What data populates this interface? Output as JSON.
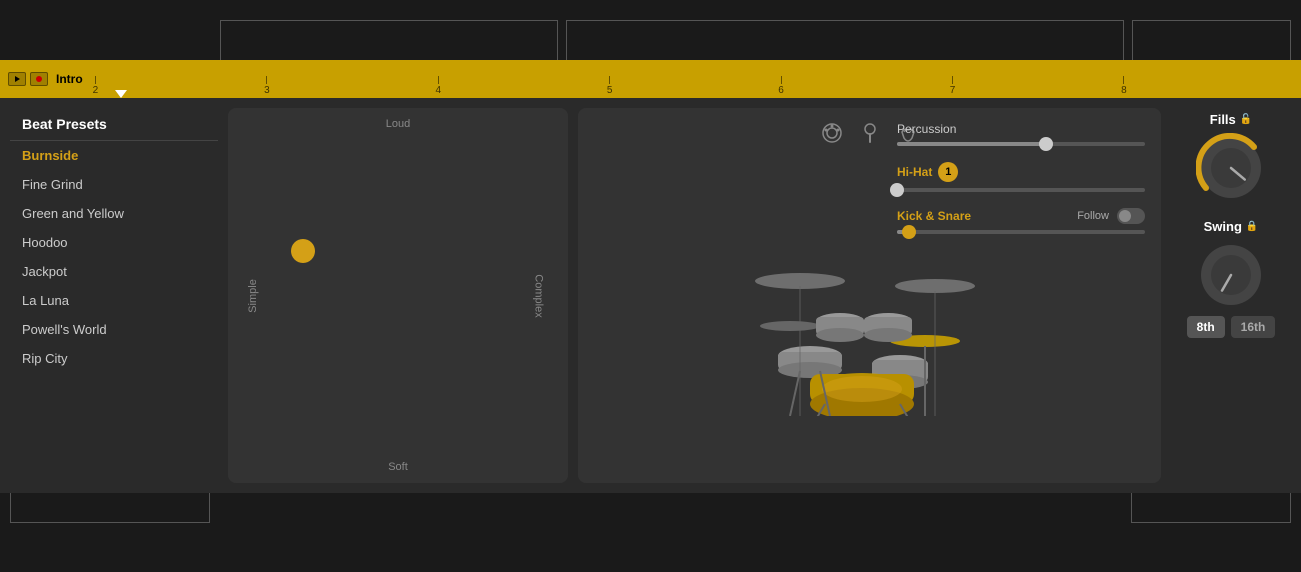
{
  "timeline": {
    "label": "Intro",
    "markers": [
      "2",
      "3",
      "4",
      "5",
      "6",
      "7",
      "8"
    ]
  },
  "sidebar": {
    "header": "Beat Presets",
    "items": [
      {
        "id": "burnside",
        "label": "Burnside",
        "active": true
      },
      {
        "id": "fine-grind",
        "label": "Fine Grind",
        "active": false
      },
      {
        "id": "green-and-yellow",
        "label": "Green and Yellow",
        "active": false
      },
      {
        "id": "hoodoo",
        "label": "Hoodoo",
        "active": false
      },
      {
        "id": "jackpot",
        "label": "Jackpot",
        "active": false
      },
      {
        "id": "la-luna",
        "label": "La Luna",
        "active": false
      },
      {
        "id": "powells-world",
        "label": "Powell's World",
        "active": false
      },
      {
        "id": "rip-city",
        "label": "Rip City",
        "active": false
      }
    ]
  },
  "beat_pad": {
    "label_loud": "Loud",
    "label_soft": "Soft",
    "label_simple": "Simple",
    "label_complex": "Complex"
  },
  "controls": {
    "percussion_label": "Percussion",
    "hihat_label": "Hi-Hat",
    "hihat_badge": "1",
    "kick_snare_label": "Kick & Snare",
    "follow_label": "Follow"
  },
  "right_panel": {
    "fills_label": "Fills",
    "swing_label": "Swing",
    "swing_8th": "8th",
    "swing_16th": "16th"
  }
}
